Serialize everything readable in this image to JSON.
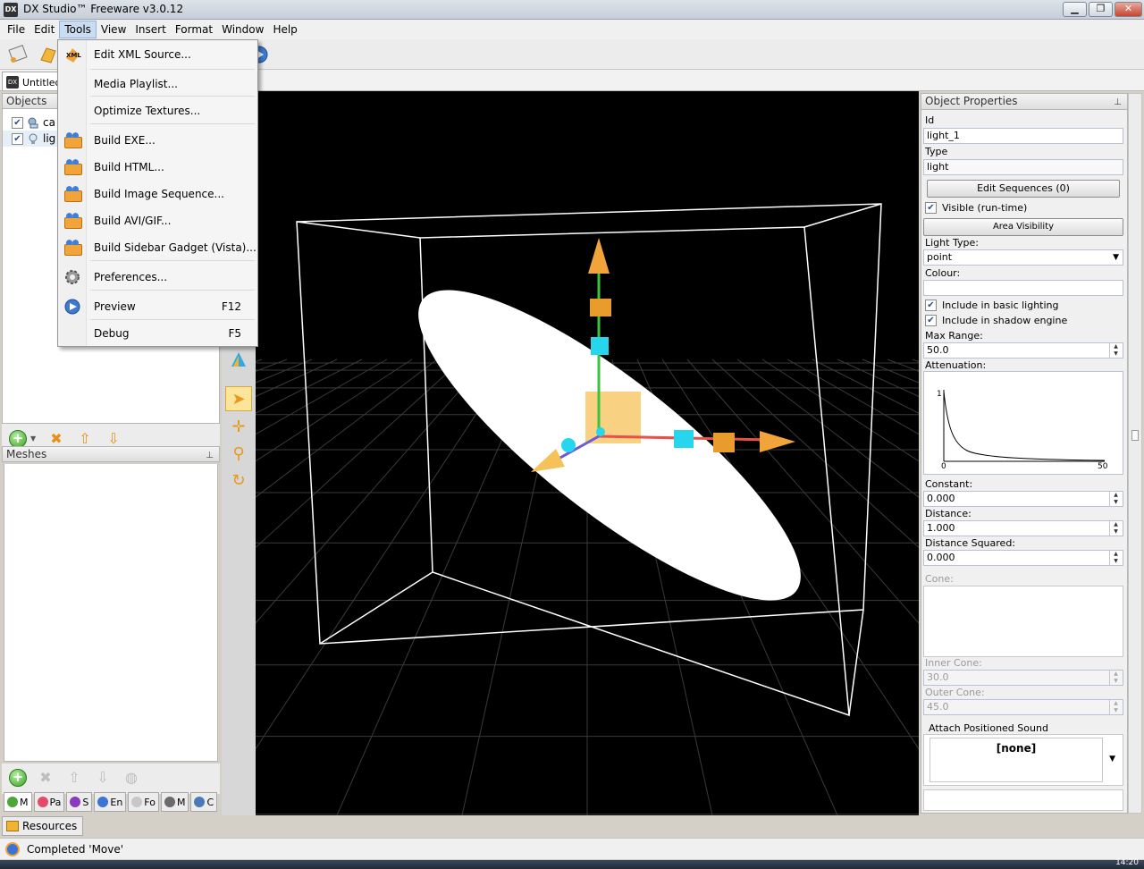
{
  "window": {
    "title": "DX Studio™ Freeware v3.0.12",
    "app_icon": "DX",
    "minimize": "▁",
    "maximize": "❐",
    "close": "✕"
  },
  "menubar": [
    "File",
    "Edit",
    "Tools",
    "View",
    "Insert",
    "Format",
    "Window",
    "Help"
  ],
  "doc_tab": "Untitled*",
  "objects_panel": {
    "title": "Objects",
    "items": [
      {
        "label": "ca",
        "checked": true,
        "icon": "camera-icon"
      },
      {
        "label": "lig",
        "checked": true,
        "icon": "lightbulb-icon"
      }
    ]
  },
  "meshes_panel": {
    "title": "Meshes"
  },
  "bottom_tabs": [
    "M",
    "Pa",
    "S",
    "En",
    "Fo",
    "M",
    "C"
  ],
  "resources_tab": "Resources",
  "status": "Completed 'Move'",
  "tools_menu": [
    {
      "label": "Edit XML Source...",
      "icon": "xml-icon",
      "shortcut": ""
    },
    {
      "label": "Media Playlist...",
      "icon": "",
      "shortcut": ""
    },
    {
      "label": "Optimize Textures...",
      "icon": "",
      "shortcut": ""
    },
    {
      "label": "Build EXE...",
      "icon": "build-brick-icon",
      "shortcut": ""
    },
    {
      "label": "Build HTML...",
      "icon": "build-brick-icon",
      "shortcut": ""
    },
    {
      "label": "Build Image Sequence...",
      "icon": "build-brick-icon",
      "shortcut": ""
    },
    {
      "label": "Build AVI/GIF...",
      "icon": "build-brick-icon",
      "shortcut": ""
    },
    {
      "label": "Build Sidebar Gadget (Vista)...",
      "icon": "build-brick-icon",
      "shortcut": ""
    },
    {
      "label": "Preferences...",
      "icon": "gear-icon",
      "shortcut": ""
    },
    {
      "label": "Preview",
      "icon": "preview-icon",
      "shortcut": "F12"
    },
    {
      "label": "Debug",
      "icon": "",
      "shortcut": "F5"
    }
  ],
  "properties": {
    "title": "Object Properties",
    "id_label": "Id",
    "id_value": "light_1",
    "type_label": "Type",
    "type_value": "light",
    "edit_sequences": "Edit Sequences (0)",
    "visible_label": "Visible (run-time)",
    "area_visibility": "Area Visibility",
    "light_type_label": "Light Type:",
    "light_type_value": "point",
    "colour_label": "Colour:",
    "basic_lighting_label": "Include in basic lighting",
    "shadow_engine_label": "Include in shadow engine",
    "max_range_label": "Max Range:",
    "max_range_value": "50.0",
    "attenuation_label": "Attenuation:",
    "graph_y_max": "1",
    "graph_x_min": "0",
    "graph_x_max": "50",
    "constant_label": "Constant:",
    "constant_value": "0.000",
    "distance_label": "Distance:",
    "distance_value": "1.000",
    "distance_sq_label": "Distance Squared:",
    "distance_sq_value": "0.000",
    "cone_label": "Cone:",
    "inner_cone_label": "Inner Cone:",
    "inner_cone_value": "30.0",
    "outer_cone_label": "Outer Cone:",
    "outer_cone_value": "45.0",
    "sound_label": "Attach Positioned Sound",
    "sound_value": "[none]"
  },
  "taskbar": {
    "clock": "14:20"
  },
  "colors": {
    "accent_orange": "#f0a43a",
    "axis_green": "#3cc23c",
    "axis_red": "#e8504a",
    "handle_cyan": "#25d6ec"
  }
}
